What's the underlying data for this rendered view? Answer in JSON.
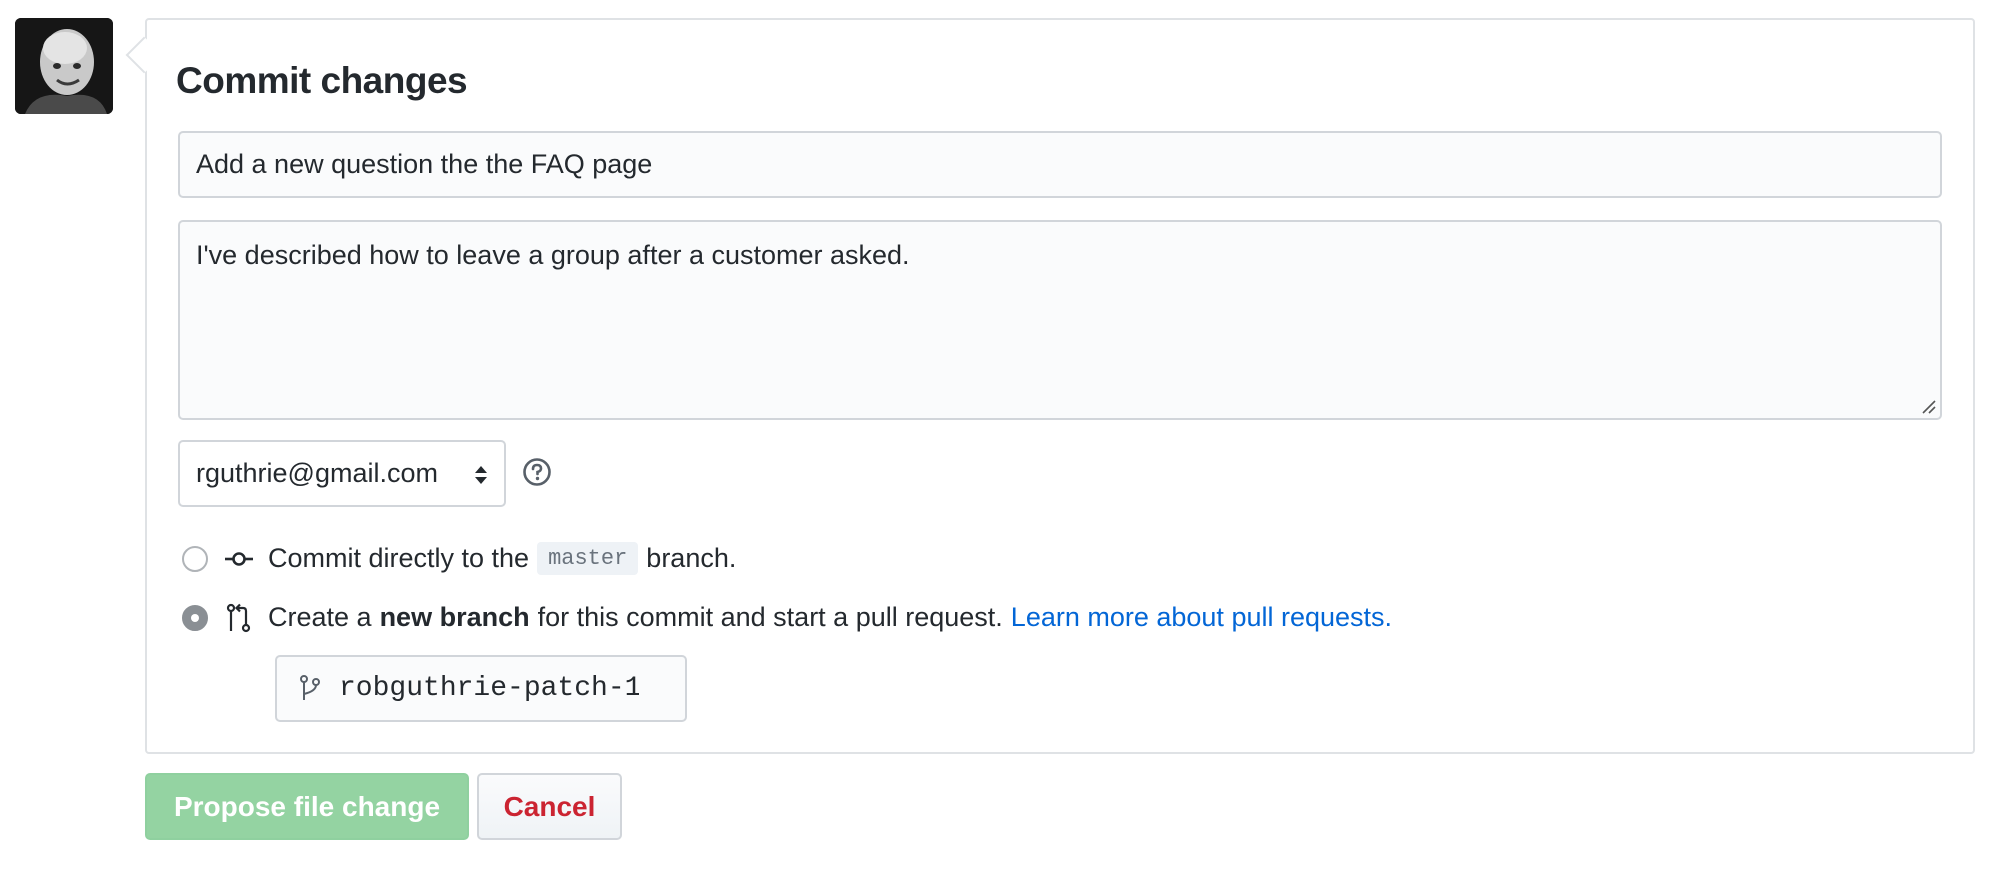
{
  "commit": {
    "title": "Commit changes",
    "summary_value": "Add a new question the the FAQ page",
    "description_value": "I've described how to leave a group after a customer asked."
  },
  "author": {
    "email_selected": "rguthrie@gmail.com"
  },
  "options": {
    "direct": {
      "prefix": "Commit directly to the",
      "branch": "master",
      "suffix": "branch.",
      "selected": false
    },
    "new_branch": {
      "prefix": "Create a",
      "bold": "new branch",
      "suffix": "for this commit and start a pull request.",
      "link": "Learn more about pull requests.",
      "selected": true
    }
  },
  "branch_name": {
    "value": "robguthrie-patch-1"
  },
  "buttons": {
    "propose": "Propose file change",
    "cancel": "Cancel"
  },
  "colors": {
    "primary_disabled": "#94d3a2",
    "cancel_text": "#cb2431",
    "link": "#0366d6"
  },
  "icons": {
    "help": "question-circle-icon",
    "commit": "git-commit-icon",
    "pull_request": "git-pull-request-icon",
    "branch": "git-branch-icon",
    "select": "select-arrows-icon"
  }
}
